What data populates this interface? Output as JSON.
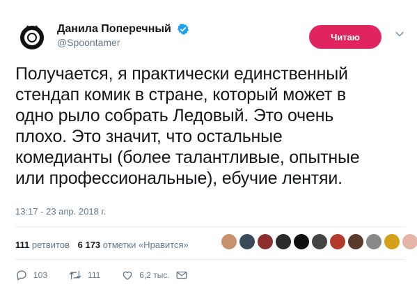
{
  "user": {
    "display_name": "Данила Поперечный",
    "handle": "@Spoontamer"
  },
  "follow_button": {
    "label": "Читаю"
  },
  "tweet": {
    "text_lines": [
      "Получается, я практически единственный",
      "стендап комик в стране, который может в",
      "одно рыло собрать Ледовый. Это очень",
      "плохо. Это значит, что остальные",
      "комедианты (более талантливые, опытные",
      "или профессиональные), ебучие лентяи."
    ],
    "timestamp": "13:17 - 23 апр. 2018 г."
  },
  "stats": {
    "retweets_count": "111",
    "retweets_label": "ретвитов",
    "likes_count": "6 173",
    "likes_label": "отметки «Нравится»",
    "liker_colors": [
      "#c8916e",
      "#3a4a5a",
      "#8b2e2e",
      "#2a2a2a",
      "#101010",
      "#444444",
      "#b23a2a",
      "#5a3a2a",
      "#888888",
      "#d4a017",
      "#e3b6a8"
    ]
  },
  "actions": {
    "replies": "103",
    "retweets": "111",
    "likes": "6,2 тыс."
  },
  "colors": {
    "follow_bg": "#e0245e",
    "verified": "#1da1f2",
    "muted": "#657786"
  }
}
